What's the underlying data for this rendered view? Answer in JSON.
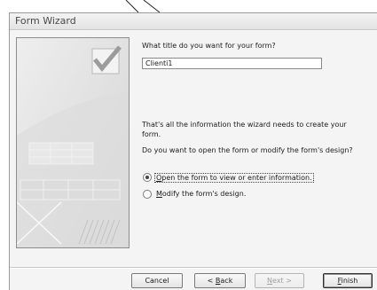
{
  "window": {
    "title": "Form Wizard"
  },
  "question": {
    "prompt": "What title do you want for your form?",
    "value": "Clienti1"
  },
  "info": {
    "line1": "That's all the information the wizard needs to create your",
    "line2": "form.",
    "question": "Do you want to open the form or modify the form's design?"
  },
  "options": {
    "open": {
      "mnemonic": "O",
      "rest": "pen the form to view or enter information.",
      "selected": true
    },
    "modify": {
      "mnemonic": "M",
      "rest": "odify the form's design.",
      "selected": false
    }
  },
  "buttons": {
    "cancel": "Cancel",
    "back_prefix": "< ",
    "back_mnemonic": "B",
    "back_rest": "ack",
    "next_mnemonic": "N",
    "next_rest": "ext >",
    "finish_mnemonic": "F",
    "finish_rest": "inish"
  }
}
